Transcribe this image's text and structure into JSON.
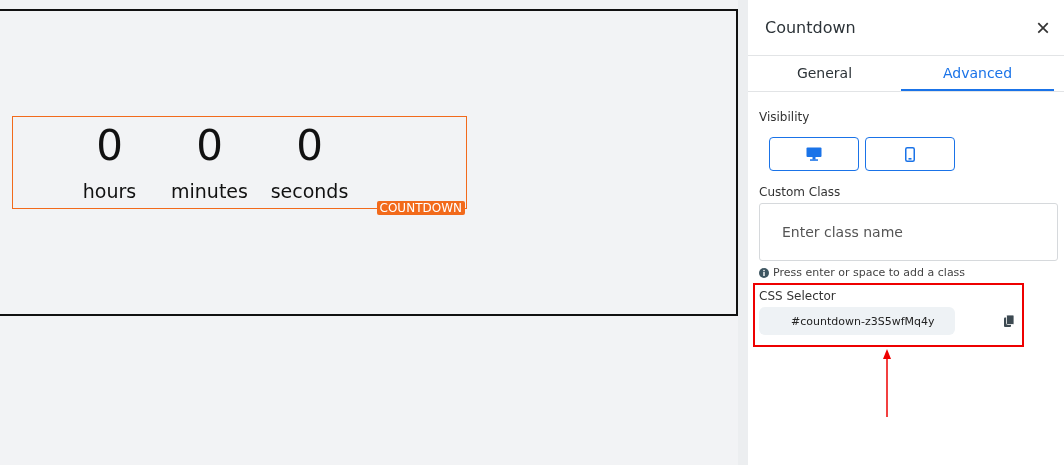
{
  "countdown": {
    "units": [
      {
        "value": "0",
        "label": "hours"
      },
      {
        "value": "0",
        "label": "minutes"
      },
      {
        "value": "0",
        "label": "seconds"
      }
    ],
    "badge": "COUNTDOWN"
  },
  "panel": {
    "title": "Countdown",
    "close": "×",
    "tabs": [
      {
        "label": "General",
        "selected": false
      },
      {
        "label": "Advanced",
        "selected": true
      }
    ],
    "visibility": {
      "label": "Visibility",
      "devices": [
        {
          "kind": "desktop",
          "selected": false
        },
        {
          "kind": "mobile",
          "selected": false
        }
      ]
    },
    "custom_class": {
      "label": "Custom Class",
      "placeholder": "Enter class name",
      "hint": "Press enter or space to add a class"
    },
    "css_selector": {
      "label": "CSS Selector",
      "value": "#countdown-z3S5wfMq4y"
    }
  }
}
